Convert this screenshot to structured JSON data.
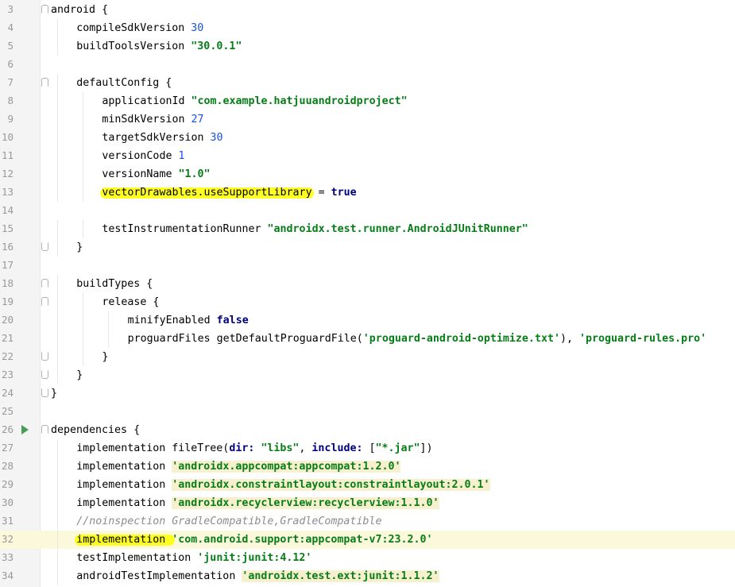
{
  "editor": {
    "lines": [
      {
        "num": "3",
        "indent": 0,
        "fold": "start",
        "tokens": [
          {
            "t": "android {",
            "c": "plain"
          }
        ]
      },
      {
        "num": "4",
        "indent": 1,
        "tokens": [
          {
            "t": "compileSdkVersion ",
            "c": "plain"
          },
          {
            "t": "30",
            "c": "num"
          }
        ]
      },
      {
        "num": "5",
        "indent": 1,
        "tokens": [
          {
            "t": "buildToolsVersion ",
            "c": "plain"
          },
          {
            "t": "\"30.0.1\"",
            "c": "str"
          }
        ]
      },
      {
        "num": "6",
        "indent": 0,
        "tokens": []
      },
      {
        "num": "7",
        "indent": 1,
        "fold": "start",
        "tokens": [
          {
            "t": "defaultConfig {",
            "c": "plain"
          }
        ]
      },
      {
        "num": "8",
        "indent": 2,
        "tokens": [
          {
            "t": "applicationId ",
            "c": "plain"
          },
          {
            "t": "\"com.example.hatjuuandroidproject\"",
            "c": "str"
          }
        ]
      },
      {
        "num": "9",
        "indent": 2,
        "tokens": [
          {
            "t": "minSdkVersion ",
            "c": "plain"
          },
          {
            "t": "27",
            "c": "num"
          }
        ]
      },
      {
        "num": "10",
        "indent": 2,
        "tokens": [
          {
            "t": "targetSdkVersion ",
            "c": "plain"
          },
          {
            "t": "30",
            "c": "num"
          }
        ]
      },
      {
        "num": "11",
        "indent": 2,
        "tokens": [
          {
            "t": "versionCode ",
            "c": "plain"
          },
          {
            "t": "1",
            "c": "num"
          }
        ]
      },
      {
        "num": "12",
        "indent": 2,
        "tokens": [
          {
            "t": "versionName ",
            "c": "plain"
          },
          {
            "t": "\"1.0\"",
            "c": "str"
          }
        ]
      },
      {
        "num": "13",
        "indent": 2,
        "mark": true,
        "tokens": [
          {
            "t": "vectorDrawables.useSupportLibrary",
            "c": "plain"
          },
          {
            "t": " = ",
            "c": "plain"
          },
          {
            "t": "true",
            "c": "kw"
          }
        ]
      },
      {
        "num": "14",
        "indent": 0,
        "tokens": []
      },
      {
        "num": "15",
        "indent": 2,
        "tokens": [
          {
            "t": "testInstrumentationRunner ",
            "c": "plain"
          },
          {
            "t": "\"androidx.test.runner.AndroidJUnitRunner\"",
            "c": "str"
          }
        ]
      },
      {
        "num": "16",
        "indent": 1,
        "fold": "end",
        "tokens": [
          {
            "t": "}",
            "c": "plain"
          }
        ]
      },
      {
        "num": "17",
        "indent": 0,
        "tokens": []
      },
      {
        "num": "18",
        "indent": 1,
        "fold": "start",
        "tokens": [
          {
            "t": "buildTypes {",
            "c": "plain"
          }
        ]
      },
      {
        "num": "19",
        "indent": 2,
        "fold": "start",
        "tokens": [
          {
            "t": "release {",
            "c": "plain"
          }
        ]
      },
      {
        "num": "20",
        "indent": 3,
        "tokens": [
          {
            "t": "minifyEnabled ",
            "c": "plain"
          },
          {
            "t": "false",
            "c": "kw"
          }
        ]
      },
      {
        "num": "21",
        "indent": 3,
        "tokens": [
          {
            "t": "proguardFiles getDefaultProguardFile(",
            "c": "plain"
          },
          {
            "t": "'proguard-android-optimize.txt'",
            "c": "str"
          },
          {
            "t": "), ",
            "c": "plain"
          },
          {
            "t": "'proguard-rules.pro'",
            "c": "str"
          }
        ]
      },
      {
        "num": "22",
        "indent": 2,
        "fold": "end",
        "tokens": [
          {
            "t": "}",
            "c": "plain"
          }
        ]
      },
      {
        "num": "23",
        "indent": 1,
        "fold": "end",
        "tokens": [
          {
            "t": "}",
            "c": "plain"
          }
        ]
      },
      {
        "num": "24",
        "indent": 0,
        "fold": "end",
        "tokens": [
          {
            "t": "}",
            "c": "plain"
          }
        ]
      },
      {
        "num": "25",
        "indent": 0,
        "tokens": []
      },
      {
        "num": "26",
        "indent": 0,
        "fold": "start",
        "run": true,
        "tokens": [
          {
            "t": "dependencies {",
            "c": "plain"
          }
        ]
      },
      {
        "num": "27",
        "indent": 1,
        "tokens": [
          {
            "t": "implementation fileTree(",
            "c": "plain"
          },
          {
            "t": "dir: ",
            "c": "kw"
          },
          {
            "t": "\"libs\"",
            "c": "str"
          },
          {
            "t": ", ",
            "c": "plain"
          },
          {
            "t": "include: ",
            "c": "kw"
          },
          {
            "t": "[",
            "c": "plain"
          },
          {
            "t": "\"*.jar\"",
            "c": "str"
          },
          {
            "t": "])",
            "c": "plain"
          }
        ]
      },
      {
        "num": "28",
        "indent": 1,
        "tokens": [
          {
            "t": "implementation ",
            "c": "plain"
          },
          {
            "t": "'androidx.appcompat:appcompat:1.2.0'",
            "c": "dep"
          }
        ]
      },
      {
        "num": "29",
        "indent": 1,
        "tokens": [
          {
            "t": "implementation ",
            "c": "plain"
          },
          {
            "t": "'androidx.constraintlayout:constraintlayout:2.0.1'",
            "c": "dep"
          }
        ]
      },
      {
        "num": "30",
        "indent": 1,
        "tokens": [
          {
            "t": "implementation ",
            "c": "plain"
          },
          {
            "t": "'androidx.recyclerview:recyclerview:1.1.0'",
            "c": "dep"
          }
        ]
      },
      {
        "num": "31",
        "indent": 1,
        "tokens": [
          {
            "t": "//noinspection GradleCompatible,GradleCompatible",
            "c": "comment"
          }
        ]
      },
      {
        "num": "32",
        "indent": 1,
        "current": true,
        "mark": true,
        "tokens": [
          {
            "t": "implementation ",
            "c": "plain"
          },
          {
            "t": "'com.android.support:appcompat-v7:23.2.0'",
            "c": "str"
          }
        ]
      },
      {
        "num": "33",
        "indent": 1,
        "tokens": [
          {
            "t": "testImplementation ",
            "c": "plain"
          },
          {
            "t": "'junit:junit:4.12'",
            "c": "str"
          }
        ]
      },
      {
        "num": "34",
        "indent": 1,
        "tokens": [
          {
            "t": "androidTestImplementation ",
            "c": "plain"
          },
          {
            "t": "'androidx.test.ext:junit:1.1.2'",
            "c": "dep"
          }
        ]
      }
    ]
  },
  "colors": {
    "keyword": "#000080",
    "string": "#067d17",
    "number": "#1750eb",
    "comment": "#8c8c8c",
    "marker": "#ffff00",
    "current_line": "#fcf8dc"
  },
  "icons": [
    "fold-icon",
    "run-gutter-icon"
  ]
}
